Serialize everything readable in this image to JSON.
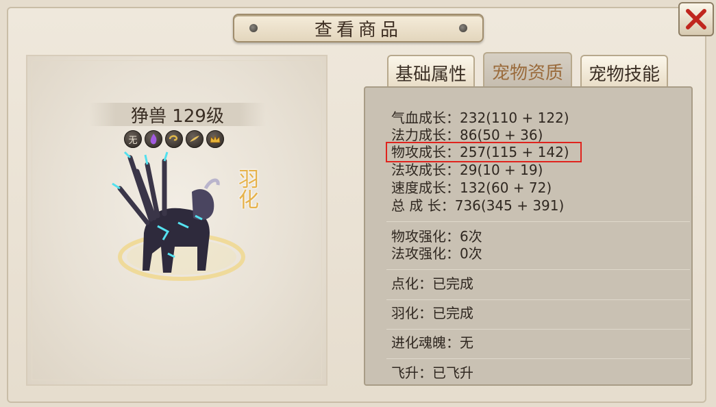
{
  "dialog": {
    "title": "查看商品"
  },
  "pet": {
    "name_line": "狰兽 129级",
    "badges": [
      "无",
      "",
      "",
      "",
      ""
    ],
    "tag": "羽化"
  },
  "tabs": [
    {
      "label": "基础属性",
      "active": false
    },
    {
      "label": "宠物资质",
      "active": true
    },
    {
      "label": "宠物技能",
      "active": false
    }
  ],
  "stats": {
    "growth": [
      "气血成长：232(110 + 122)",
      "法力成长：86(50 + 36)",
      "物攻成长：257(115 + 142)",
      "法攻成长：29(10 + 19)",
      "速度成长：132(60 + 72)",
      "总 成 长：736(345 + 391)"
    ],
    "enhance": [
      "物攻强化：6次",
      "法攻强化：0次"
    ],
    "dianhua": "点化：已完成",
    "yuhua": "羽化：已完成",
    "evolution": "进化魂魄：无",
    "feisheng": "飞升：已飞升"
  },
  "colors": {
    "highlight": "#e0231d",
    "close_x": "#c0261e",
    "active_tab_text": "#9a6b3c"
  }
}
